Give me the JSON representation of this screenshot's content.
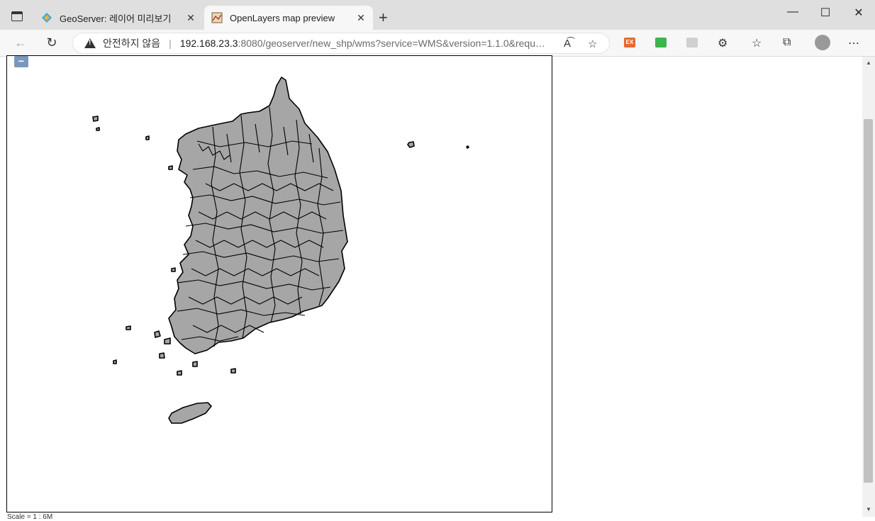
{
  "tabs": [
    {
      "label": "GeoServer: 레이어 미리보기",
      "icon": "geoserver-icon"
    },
    {
      "label": "OpenLayers map preview",
      "icon": "openlayers-map-icon"
    }
  ],
  "addressbar": {
    "security_text": "안전하지 않음",
    "url_host": "192.168.23.3",
    "url_rest": ":8080/geoserver/new_shp/wms?service=WMS&version=1.1.0&request..."
  },
  "extensions": [
    {
      "name": "ex-extension",
      "label": "EX",
      "color": "#e8692c"
    },
    {
      "name": "green-extension",
      "label": "",
      "color": "#3cb54a"
    },
    {
      "name": "gray-extension",
      "label": "",
      "color": "#cfcfcf"
    }
  ],
  "map": {
    "zoom_out_label": "−",
    "footer_text": "Scale = 1 : 6M",
    "fill_color": "#a6a6a6",
    "stroke_color": "#000000"
  },
  "window_controls": {
    "minimize": "—",
    "maximize": "☐",
    "close": "✕"
  }
}
